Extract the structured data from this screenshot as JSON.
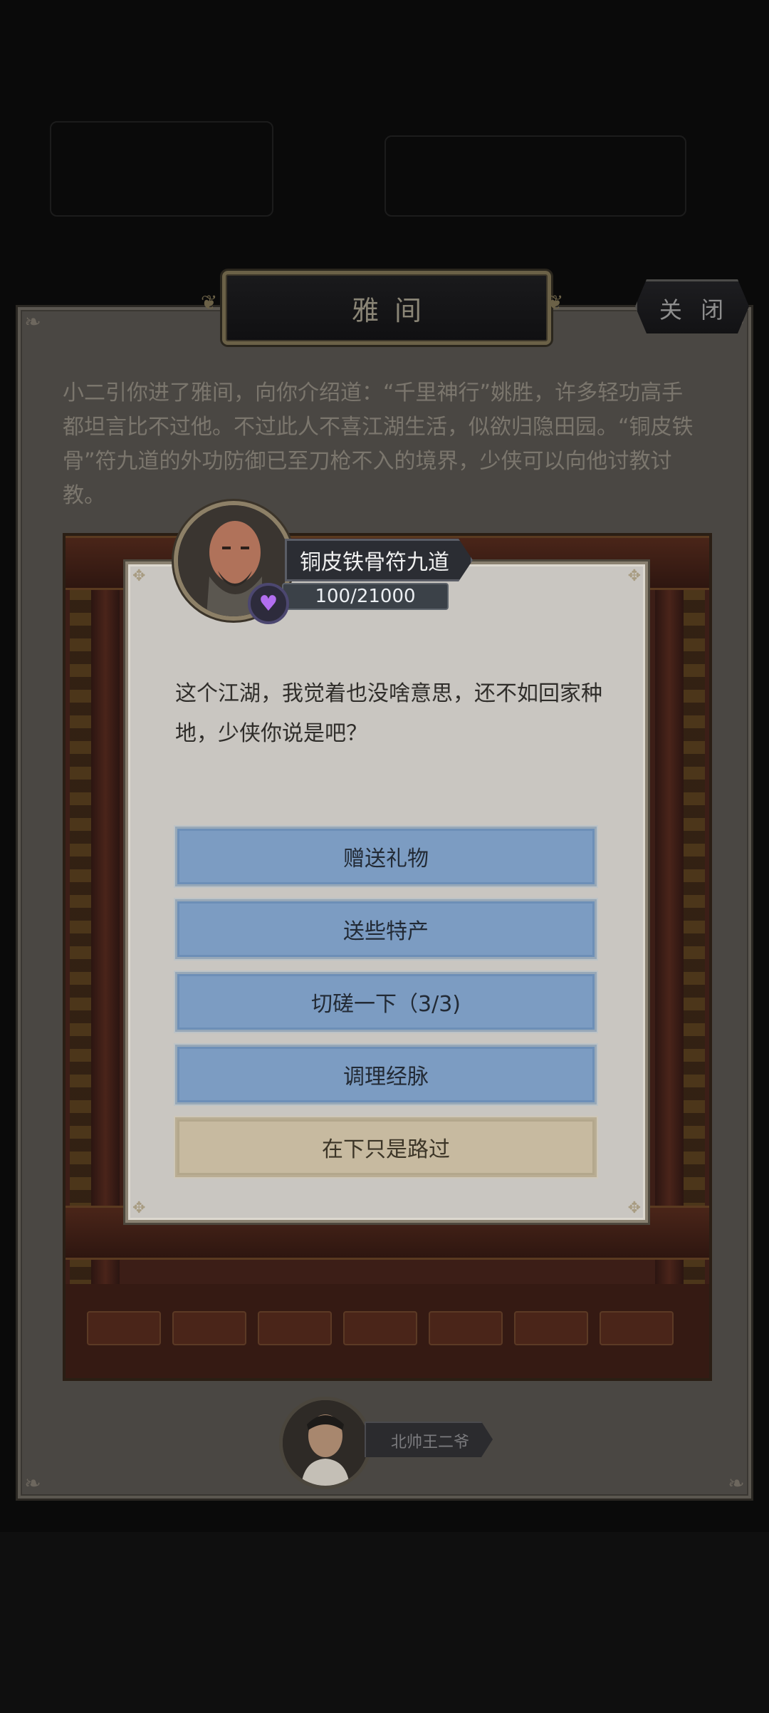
{
  "window": {
    "title": "雅间",
    "close_label": "关 闭"
  },
  "intro": {
    "text": "小二引你进了雅间，向你介绍道：“千里神行”姚胜，许多轻功高手都坦言比不过他。不过此人不喜江湖生活，似欲归隐田园。“铜皮铁骨”符九道的外功防御已至刀枪不入的境界，少侠可以向他讨教讨教。"
  },
  "npc": {
    "name": "铜皮铁骨符九道",
    "affinity": "100/21000",
    "affinity_icon": "heart-icon",
    "dialog": "这个江湖，我觉着也没啥意思，还不如回家种地，少侠你说是吧？"
  },
  "options": [
    {
      "label": "赠送礼物"
    },
    {
      "label": "送些特产"
    },
    {
      "label": "切磋一下（3/3)"
    },
    {
      "label": "调理经脉"
    },
    {
      "label": "在下只是路过"
    }
  ],
  "player": {
    "name": "北帅王二爷"
  },
  "colors": {
    "option_blue": "#7c9cc2",
    "option_pass": "#c7baa0",
    "panel": "#4a4743",
    "dialog_bg": "#c9c6c1"
  }
}
